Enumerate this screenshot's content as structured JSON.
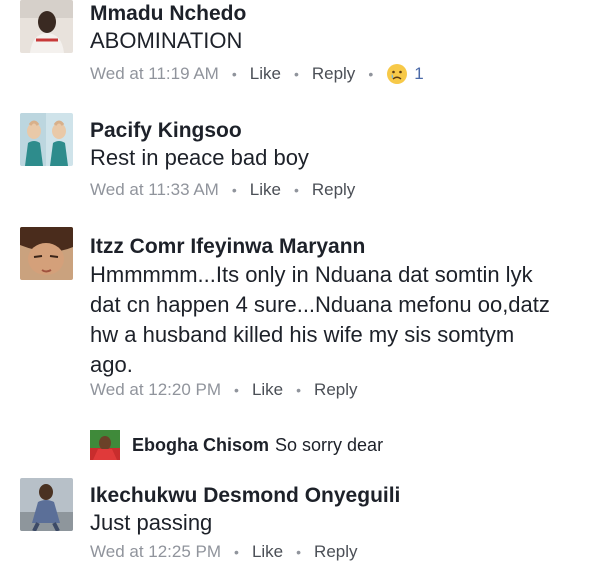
{
  "comments": [
    {
      "name": "Mmadu Nchedo",
      "text": "ABOMINATION",
      "time": "Wed at 11:19 AM",
      "like": "Like",
      "reply": "Reply",
      "reaction_icon": "sad-face-icon",
      "reaction_count": "1"
    },
    {
      "name": "Pacify Kingsoo",
      "text": "Rest in peace bad boy",
      "time": "Wed at 11:33 AM",
      "like": "Like",
      "reply": "Reply"
    },
    {
      "name": "Itzz Comr Ifeyinwa Maryann",
      "text_lines": [
        "Hmmmmm...Its only in Nduana dat somtin lyk",
        "dat cn happen 4 sure...Nduana mefonu oo,datz",
        "hw a husband killed his wife my sis somtym",
        "ago."
      ],
      "time": "Wed at 12:20 PM",
      "like": "Like",
      "reply": "Reply",
      "reply_preview": {
        "name": "Ebogha Chisom",
        "text": "So sorry dear"
      }
    },
    {
      "name": "Ikechukwu Desmond Onyeguili",
      "text": "Just passing",
      "time": "Wed at 12:25 PM",
      "like": "Like",
      "reply": "Reply"
    }
  ],
  "separator": "•"
}
